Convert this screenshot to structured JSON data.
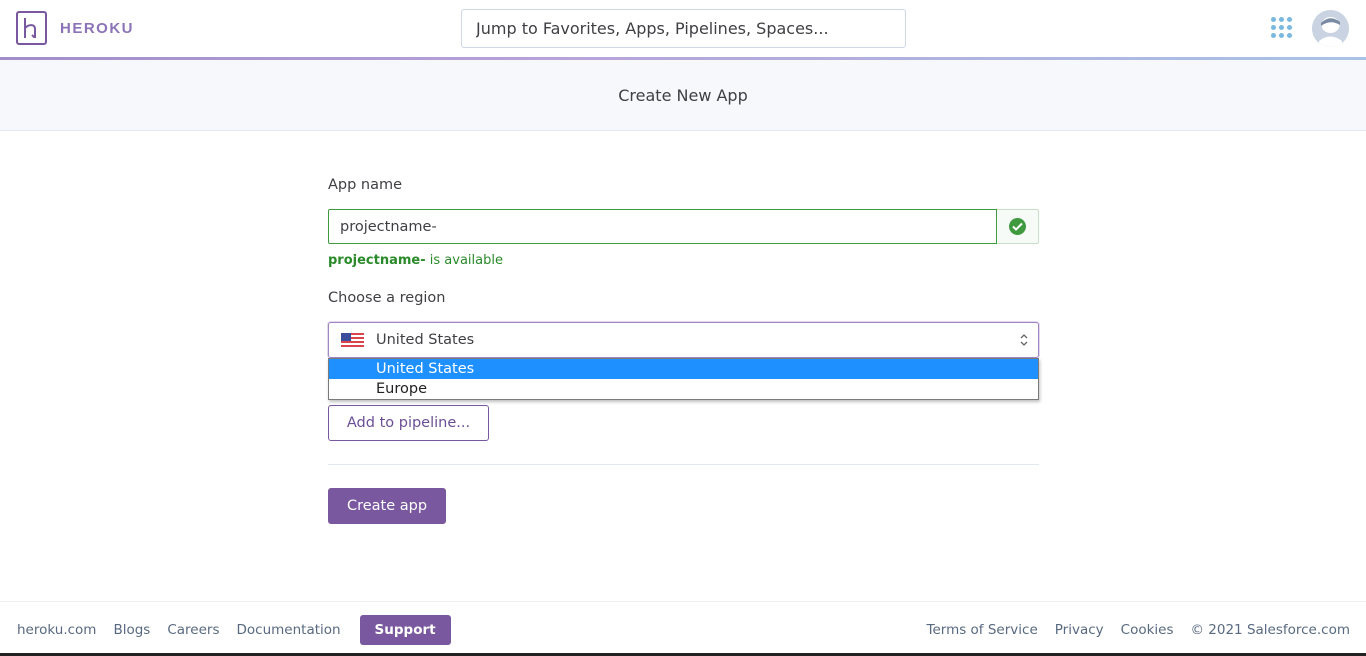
{
  "header": {
    "logo_text": "HEROKU",
    "search_placeholder": "Jump to Favorites, Apps, Pipelines, Spaces...",
    "apps_icon": "grid-icon",
    "avatar_icon": "user-avatar"
  },
  "page": {
    "title": "Create New App"
  },
  "form": {
    "app_name_label": "App name",
    "app_name_value": "projectname-",
    "availability": {
      "name": "projectname-",
      "suffix": " is available"
    },
    "region_label": "Choose a region",
    "region_selected": "United States",
    "region_flag": "us-flag",
    "region_options": [
      "United States",
      "Europe"
    ],
    "pipeline_button": "Add to pipeline...",
    "create_button": "Create app"
  },
  "footer": {
    "links_left": [
      "heroku.com",
      "Blogs",
      "Careers",
      "Documentation"
    ],
    "support_button": "Support",
    "links_right": [
      "Terms of Service",
      "Privacy",
      "Cookies"
    ],
    "copyright": "© 2021 Salesforce.com"
  },
  "colors": {
    "brand_purple": "#79589f",
    "success_green": "#3f9a3f",
    "selected_option": "#1e90ff"
  }
}
